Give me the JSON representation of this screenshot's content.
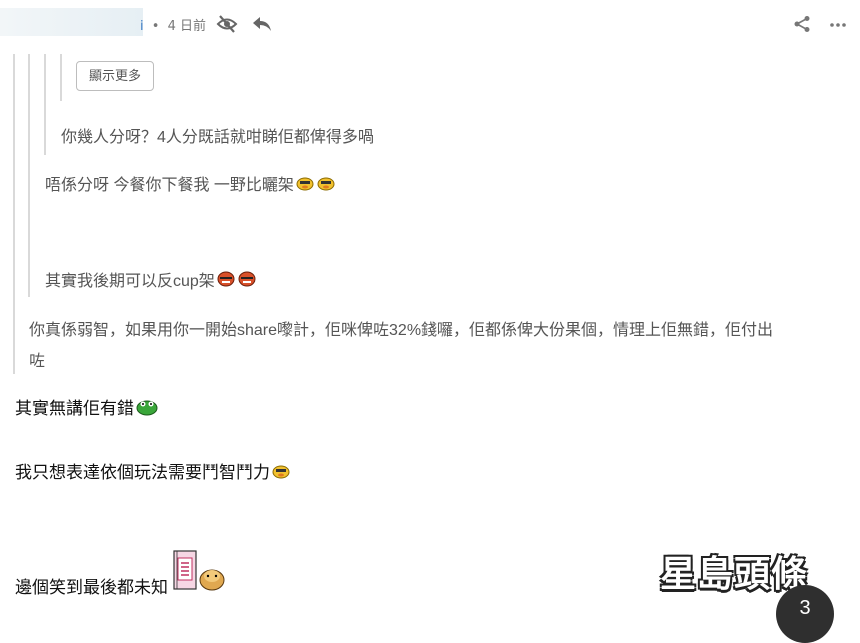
{
  "header": {
    "username_tail": "i",
    "separator": "•",
    "time_ago": "4 日前",
    "icons": [
      "hide-icon",
      "reply-icon",
      "share-icon",
      "more-icon"
    ]
  },
  "thread": {
    "show_more_label": "顯示更多",
    "quotes": [
      "你幾人分呀？4人分既話就咁睇佢都俾得多喎",
      "唔係分呀 今餐你下餐我 一野比曬架",
      "其實我後期可以反cup架",
      "你真係弱智，如果用你一開始share嚟計，佢咪俾咗32%錢囉，佢都係俾大份果個，情理上佢無錯，佢付出",
      "咗"
    ]
  },
  "main_post": {
    "lines": [
      "其實無講佢有錯",
      "我只想表達依個玩法需要鬥智鬥力",
      "邊個笑到最後都未知"
    ]
  },
  "watermark": {
    "text": "星島頭條"
  },
  "page_number": "3",
  "colors": {
    "quote_bar": "#d9d9d9",
    "meta_text": "#777777",
    "link_blue": "#3b7cc4"
  }
}
